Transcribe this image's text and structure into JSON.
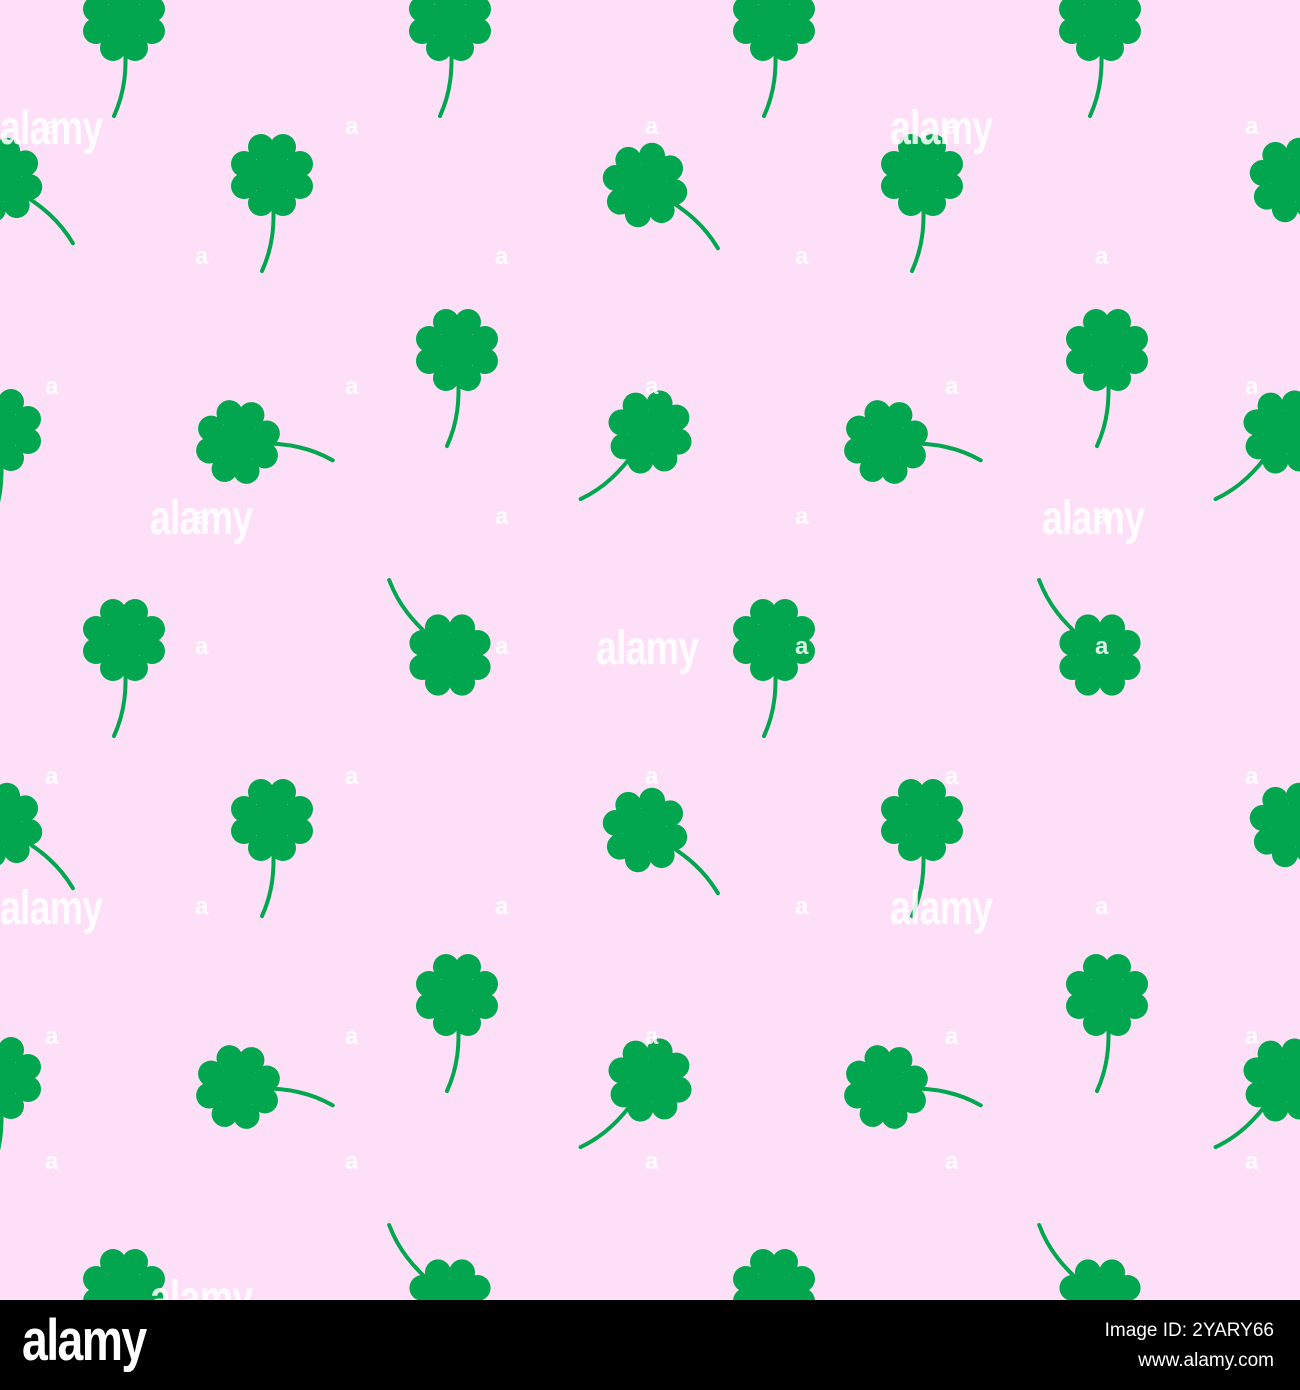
{
  "pattern": {
    "background_color": "#fde0f8",
    "clover_color": "#02a64f",
    "motif_icon": "four-leaf-clover-icon"
  },
  "watermark": {
    "word": "alamy",
    "letter": "a"
  },
  "footer": {
    "brand": "alamy",
    "image_id": "Image ID: 2YARY66",
    "site": "www.alamy.com"
  }
}
